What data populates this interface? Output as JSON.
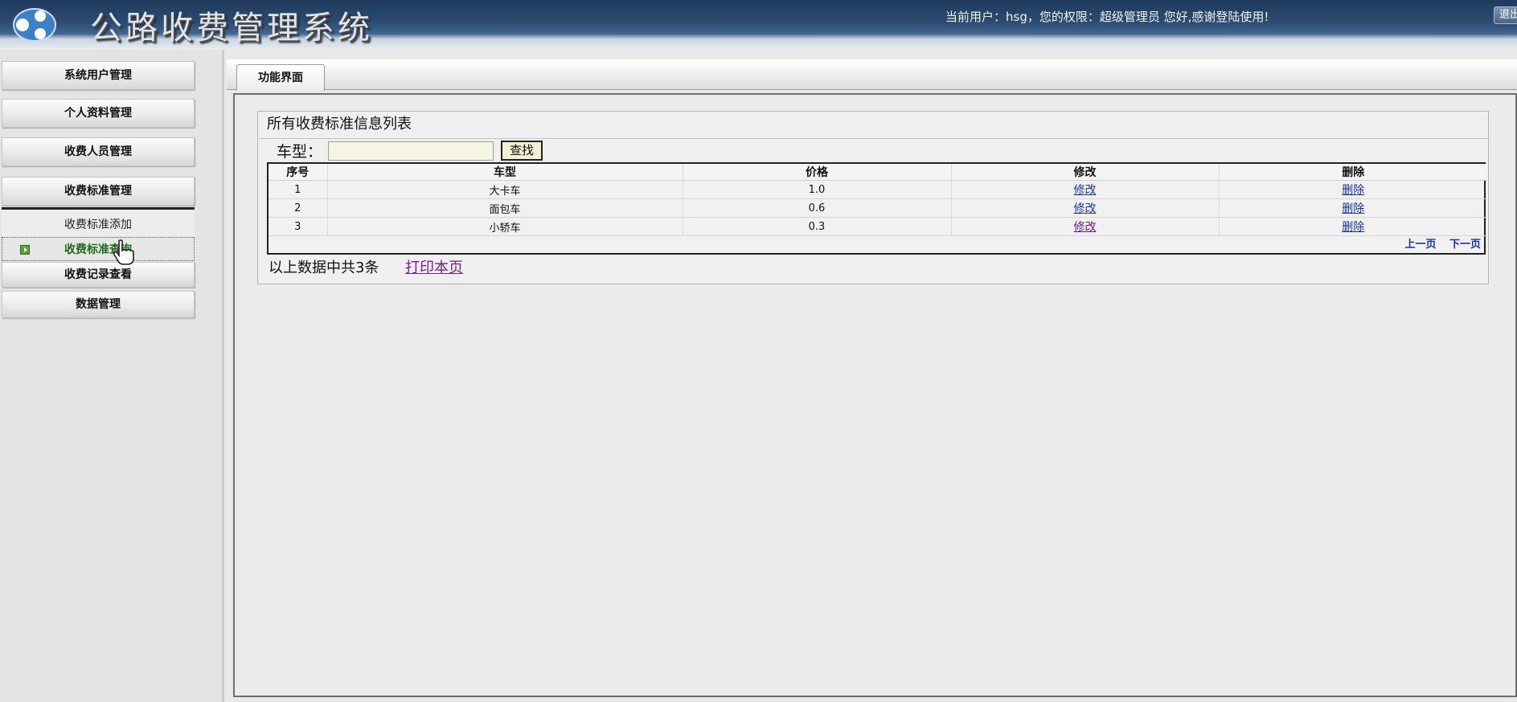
{
  "header": {
    "app_title": "公路收费管理系统",
    "user_info": "当前用户：hsg，您的权限：超级管理员 您好,感谢登陆使用!",
    "logout_label": "退出"
  },
  "sidebar": {
    "items": [
      {
        "label": "系统用户管理"
      },
      {
        "label": "个人资料管理"
      },
      {
        "label": "收费人员管理"
      },
      {
        "label": "收费标准管理"
      },
      {
        "label": "收费记录查看"
      },
      {
        "label": "数据管理"
      }
    ],
    "submenu": {
      "add_label": "收费标准添加",
      "query_label": "收费标准查询"
    }
  },
  "main": {
    "tab_label": "功能界面",
    "list_title": "所有收费标准信息列表",
    "search": {
      "label": "车型：",
      "value": "",
      "button_label": "查找"
    },
    "table": {
      "columns": [
        "序号",
        "车型",
        "价格",
        "修改",
        "删除"
      ],
      "rows": [
        {
          "index": "1",
          "vehicle_type": "大卡车",
          "price": "1.0",
          "edit": "修改",
          "delete": "删除"
        },
        {
          "index": "2",
          "vehicle_type": "面包车",
          "price": "0.6",
          "edit": "修改",
          "delete": "删除"
        },
        {
          "index": "3",
          "vehicle_type": "小轿车",
          "price": "0.3",
          "edit": "修改",
          "delete": "删除"
        }
      ],
      "pager": {
        "prev": "上一页",
        "next": "下一页"
      }
    },
    "footer": {
      "count_text": "以上数据中共3条",
      "print_label": "打印本页"
    }
  },
  "colors": {
    "header_dark": "#1f3a5c",
    "active_menu": "#1d6b18",
    "link": "#1a33a3",
    "visited_link": "#6a1a8a"
  }
}
